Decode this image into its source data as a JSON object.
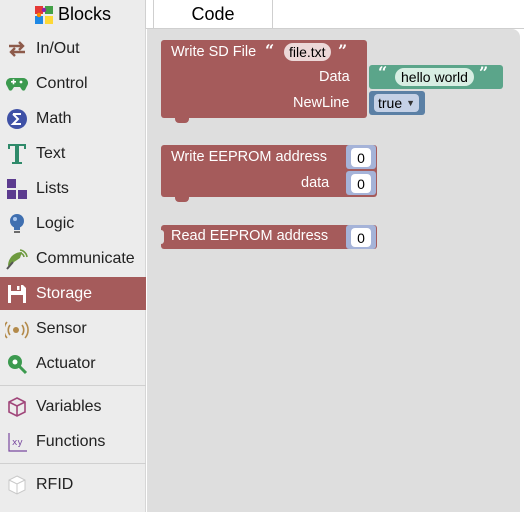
{
  "tabs": {
    "blocks": "Blocks",
    "code": "Code"
  },
  "toolbox": {
    "categories": [
      {
        "label": "In/Out",
        "icon": "swap-arrows-icon"
      },
      {
        "label": "Control",
        "icon": "gamepad-icon"
      },
      {
        "label": "Math",
        "icon": "sigma-icon"
      },
      {
        "label": "Text",
        "icon": "letter-t-icon"
      },
      {
        "label": "Lists",
        "icon": "blocks-list-icon"
      },
      {
        "label": "Logic",
        "icon": "lightbulb-icon"
      },
      {
        "label": "Communicate",
        "icon": "satellite-dish-icon"
      },
      {
        "label": "Storage",
        "icon": "floppy-disk-icon",
        "selected": true
      },
      {
        "label": "Sensor",
        "icon": "sensor-waves-icon"
      },
      {
        "label": "Actuator",
        "icon": "actuator-icon"
      },
      {
        "label": "Variables",
        "icon": "cube-outline-icon"
      },
      {
        "label": "Functions",
        "icon": "function-xy-icon"
      },
      {
        "label": "RFID",
        "icon": "rfid-box-icon"
      }
    ]
  },
  "workspace": {
    "write_sd": {
      "title": "Write SD File",
      "filename": "file.txt",
      "data_label": "Data",
      "data_value": "hello world",
      "newline_label": "NewLine",
      "newline_value": "true"
    },
    "write_eeprom": {
      "title": "Write EEPROM address",
      "address_value": "0",
      "data_label": "data",
      "data_value": "0"
    },
    "read_eeprom": {
      "title": "Read EEPROM address",
      "address_value": "0"
    }
  },
  "colors": {
    "storage_block": "#a55b5b",
    "text_block": "#5ba58a",
    "logic_block": "#5b80a5",
    "math_block": "#a5b3d8",
    "toolbox_bg": "#ececec",
    "workspace_bg": "#dedede",
    "selected_category": "#a55b5b"
  }
}
